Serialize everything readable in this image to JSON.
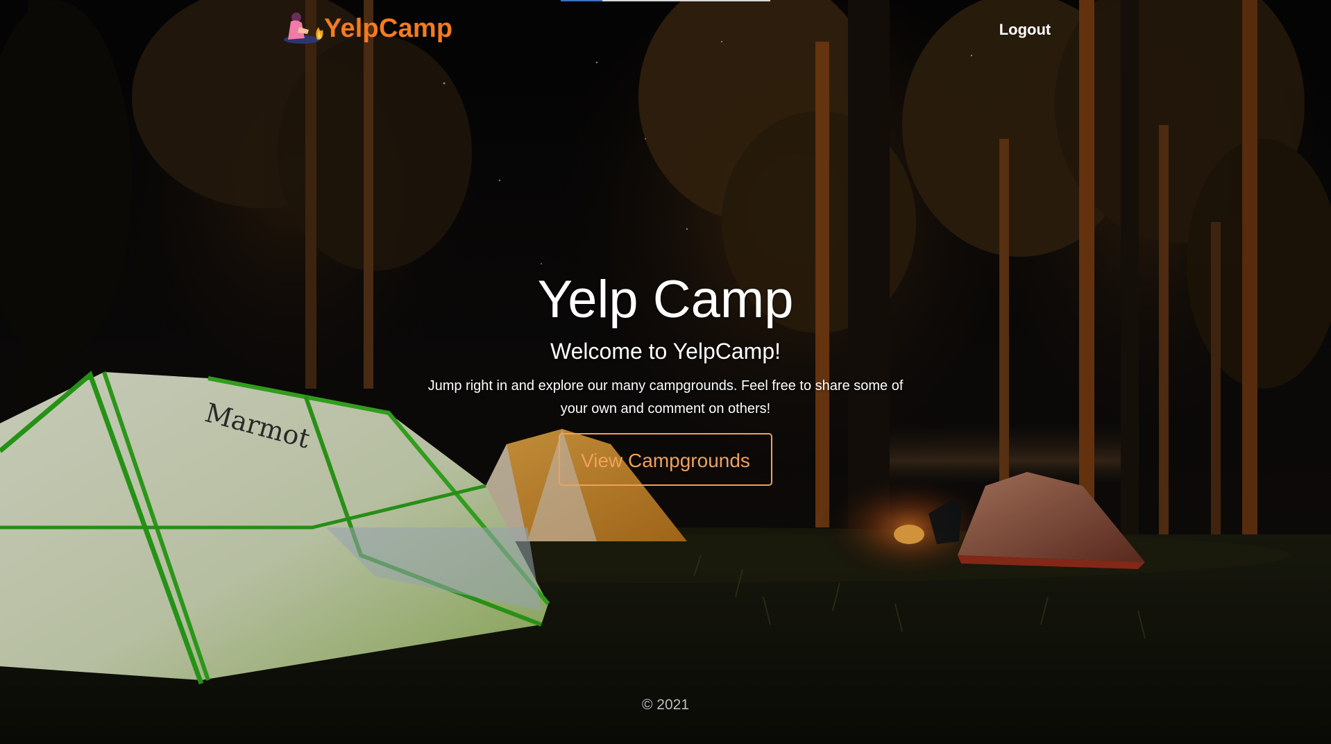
{
  "nav": {
    "brand_name": "YelpCamp",
    "logout_label": "Logout"
  },
  "cover": {
    "title": "Yelp Camp",
    "subtitle": "Welcome to YelpCamp!",
    "description": "Jump right in and explore our many campgrounds. Feel free to share some of your own and comment on others!",
    "cta_label": "View Campgrounds"
  },
  "footer": {
    "copyright": "© 2021"
  },
  "colors": {
    "brand_accent": "#f47b20",
    "cta_accent": "#f0a15a",
    "text_primary": "#ffffff",
    "footer_text": "#bdbdbd"
  },
  "icons": {
    "brand_logo": "camper-by-campfire-icon"
  }
}
